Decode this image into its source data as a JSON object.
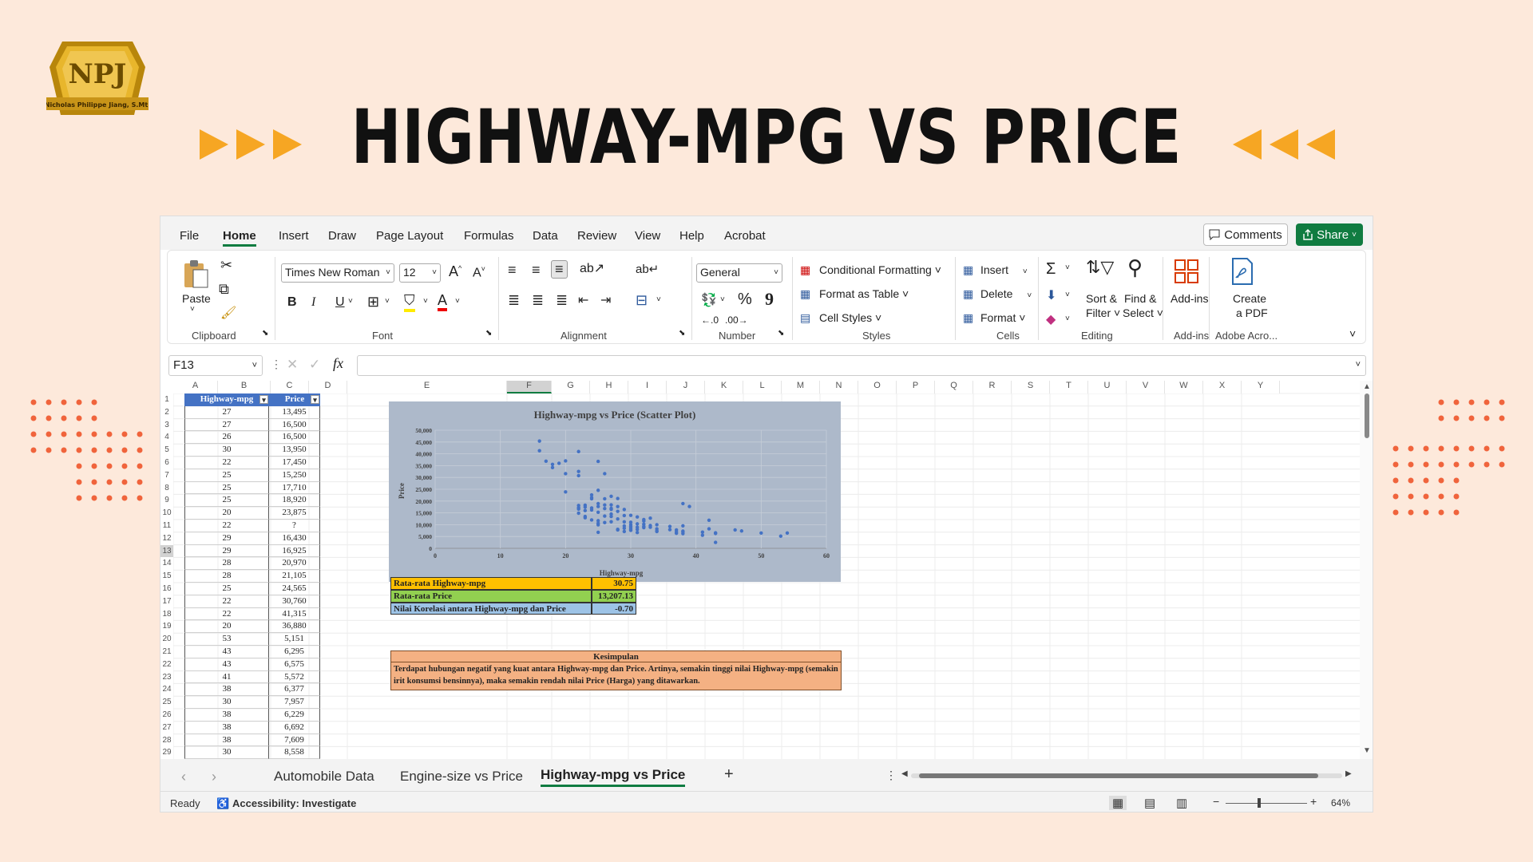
{
  "title": "HIGHWAY-MPG VS PRICE",
  "logo": {
    "monogram": "NPJ",
    "name": "Nicholas Philippe Jiang, S.Mt."
  },
  "menu": [
    "File",
    "Home",
    "Insert",
    "Draw",
    "Page Layout",
    "Formulas",
    "Data",
    "Review",
    "View",
    "Help",
    "Acrobat"
  ],
  "menu_active": "Home",
  "buttons": {
    "comments": "Comments",
    "share": "Share"
  },
  "ribbon": {
    "clipboard": {
      "paste": "Paste",
      "group": "Clipboard"
    },
    "font": {
      "family": "Times New Roman",
      "size": "12",
      "bold": "B",
      "italic": "I",
      "underline": "U",
      "grow": "A^",
      "shrink": "A˅",
      "group": "Font"
    },
    "alignment": {
      "group": "Alignment"
    },
    "number": {
      "format": "General",
      "percent": "%",
      "comma": "9",
      "group": "Number"
    },
    "styles": {
      "conditional": "Conditional Formatting",
      "table": "Format as Table",
      "cell_styles": "Cell Styles",
      "group": "Styles"
    },
    "cells": {
      "insert": "Insert",
      "delete": "Delete",
      "format": "Format",
      "group": "Cells"
    },
    "editing": {
      "sum": "Σ",
      "sort_line1": "Sort &",
      "sort_line2": "Filter",
      "find_line1": "Find &",
      "find_line2": "Select",
      "group": "Editing"
    },
    "addins": {
      "label": "Add-ins",
      "group": "Add-ins"
    },
    "acrobat": {
      "line1": "Create",
      "line2": "a PDF",
      "group": "Adobe Acro..."
    }
  },
  "namebox": "F13",
  "fx": "fx",
  "columns": [
    "A",
    "B",
    "C",
    "D",
    "E",
    "F",
    "G",
    "H",
    "I",
    "J",
    "K",
    "L",
    "M",
    "N",
    "O",
    "P",
    "Q",
    "R",
    "S",
    "T",
    "U",
    "V",
    "W",
    "X",
    "Y"
  ],
  "table": {
    "headers": [
      "Highway-mpg",
      "Price"
    ],
    "rows": [
      [
        "27",
        "13,495"
      ],
      [
        "27",
        "16,500"
      ],
      [
        "26",
        "16,500"
      ],
      [
        "30",
        "13,950"
      ],
      [
        "22",
        "17,450"
      ],
      [
        "25",
        "15,250"
      ],
      [
        "25",
        "17,710"
      ],
      [
        "25",
        "18,920"
      ],
      [
        "20",
        "23,875"
      ],
      [
        "22",
        "?"
      ],
      [
        "29",
        "16,430"
      ],
      [
        "29",
        "16,925"
      ],
      [
        "28",
        "20,970"
      ],
      [
        "28",
        "21,105"
      ],
      [
        "25",
        "24,565"
      ],
      [
        "22",
        "30,760"
      ],
      [
        "22",
        "41,315"
      ],
      [
        "20",
        "36,880"
      ],
      [
        "53",
        "5,151"
      ],
      [
        "43",
        "6,295"
      ],
      [
        "43",
        "6,575"
      ],
      [
        "41",
        "5,572"
      ],
      [
        "38",
        "6,377"
      ],
      [
        "30",
        "7,957"
      ],
      [
        "38",
        "6,229"
      ],
      [
        "38",
        "6,692"
      ],
      [
        "38",
        "7,609"
      ],
      [
        "30",
        "8,558"
      ]
    ]
  },
  "stats": [
    {
      "label": "Rata-rata Highway-mpg",
      "value": "30.75",
      "color": "#ffc000"
    },
    {
      "label": "Rata-rata Price",
      "value": "13,207.13",
      "color": "#92d050"
    },
    {
      "label": "Nilai Korelasi antara Highway-mpg dan Price",
      "value": "-0.70",
      "color": "#9dc3e6"
    }
  ],
  "conclusion": {
    "heading": "Kesimpulan",
    "text": "Terdapat hubungan negatif yang kuat antara Highway-mpg dan Price. Artinya, semakin tinggi nilai Highway-mpg (semakin irit konsumsi bensinnya), maka semakin rendah nilai Price (Harga) yang ditawarkan."
  },
  "chart_data": {
    "type": "scatter",
    "title": "Highway-mpg vs Price (Scatter Plot)",
    "xlabel": "Highway-mpg",
    "ylabel": "Price",
    "xlim": [
      0,
      60
    ],
    "ylim": [
      0,
      50000
    ],
    "xticks": [
      "0",
      "10",
      "20",
      "30",
      "40",
      "50",
      "60"
    ],
    "yticks": [
      "0",
      "5,000",
      "10,000",
      "15,000",
      "20,000",
      "25,000",
      "30,000",
      "35,000",
      "40,000",
      "45,000",
      "50,000"
    ],
    "grid": true,
    "series": [
      {
        "color": "#4472c4",
        "x": [
          16,
          16,
          17,
          18,
          18,
          19,
          20,
          20,
          20,
          22,
          22,
          22,
          22,
          22,
          22,
          22,
          23,
          23,
          23,
          23,
          23,
          24,
          24,
          24,
          24,
          24,
          24,
          25,
          25,
          25,
          25,
          25,
          25,
          25,
          25,
          25,
          26,
          26,
          26,
          26,
          26,
          26,
          27,
          27,
          27,
          27,
          27,
          27,
          27,
          28,
          28,
          28,
          28,
          28,
          28,
          29,
          29,
          29,
          29,
          29,
          29,
          30,
          30,
          30,
          30,
          30,
          30,
          30,
          31,
          31,
          31,
          31,
          31,
          32,
          32,
          32,
          32,
          32,
          33,
          33,
          33,
          34,
          34,
          34,
          34,
          36,
          36,
          37,
          37,
          37,
          38,
          38,
          38,
          38,
          38,
          39,
          41,
          41,
          42,
          42,
          43,
          43,
          43,
          46,
          47,
          50,
          53,
          54
        ],
        "y": [
          45400,
          41315,
          36880,
          35550,
          34184,
          36000,
          37000,
          31600,
          23875,
          40960,
          32528,
          30760,
          18150,
          17199,
          16630,
          14869,
          18280,
          17450,
          15998,
          13499,
          12940,
          22625,
          21485,
          20970,
          17075,
          16238,
          12000,
          36800,
          24565,
          18920,
          17710,
          15250,
          11694,
          10595,
          9960,
          6785,
          31600,
          20970,
          18344,
          16845,
          13645,
          10898,
          22018,
          18399,
          16925,
          16500,
          14489,
          13495,
          11259,
          21105,
          17669,
          15645,
          12440,
          8058,
          7775,
          16430,
          13860,
          11199,
          9495,
          8495,
          7129,
          13950,
          11048,
          9988,
          9233,
          8558,
          7957,
          7609,
          13295,
          10345,
          8948,
          8013,
          6692,
          12170,
          11549,
          10198,
          9258,
          8778,
          12764,
          9639,
          8921,
          9989,
          8238,
          7395,
          7099,
          9279,
          7898,
          7788,
          6989,
          6377,
          18950,
          9538,
          7299,
          6918,
          6229,
          17710,
          6855,
          5572,
          11900,
          8249,
          6575,
          6295,
          2500,
          7775,
          7349,
          6479,
          5151,
          6479
        ]
      }
    ]
  }
}
